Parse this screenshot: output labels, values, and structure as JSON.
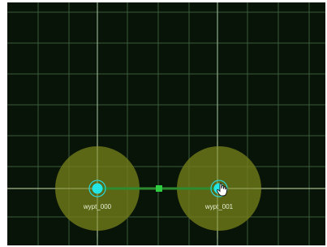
{
  "map": {
    "background": "#091409",
    "grid_color": "#3c5a3c",
    "axis_color": "#8fae8a",
    "waypoints": [
      {
        "id": "wypt_000",
        "label": "wypt_000",
        "selected": false
      },
      {
        "id": "wypt_001",
        "label": "wypt_001",
        "selected": true
      }
    ],
    "path_color": "#2e8a2e",
    "midpoint_handle_color": "#2ecc40",
    "waypoint_fill": "#22e6e6",
    "radius_fill": "#6f7a1a"
  }
}
